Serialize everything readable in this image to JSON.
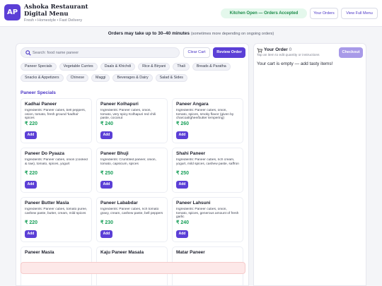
{
  "header": {
    "logo_text": "AP",
    "title": "Ashoka Restaurant Digital Menu",
    "subtitle": "Fresh • Homestyle • Fast Delivery",
    "status": "Kitchen Open — Orders Accepted",
    "orders_label": "Your Orders",
    "menu_label": "View Full Menu"
  },
  "notice": {
    "main": "Orders may take up to 30–40 minutes",
    "small": "(sometimes more depending on ongoing orders)"
  },
  "toolbar": {
    "search_placeholder": "Search: food name paneer",
    "clear_label": "Clear Cart",
    "review_label": "Review Order"
  },
  "categories": [
    [
      "Paneer Specials",
      "Vegetable Curries",
      "Daals & Khichdi",
      "Rice & Biryani",
      "Thali",
      "Breads & Paratha"
    ],
    [
      "Snacks & Appetizers",
      "Chinese",
      "Maggi",
      "Beverages & Dairy",
      "Salad & Sides"
    ]
  ],
  "section": {
    "title": "Paneer Specials"
  },
  "items": [
    {
      "name": "Kadhai Paneer",
      "ingredients": "Ingredients: Paneer cubes, bell peppers, onion, tomato, fresh ground 'kadhai' spices",
      "price": "₹ 220",
      "add": "Add"
    },
    {
      "name": "Paneer Kolhapuri",
      "ingredients": "Ingredients: Paneer cubes, onion, tomato, very spicy Kolhapuri red chili paste, coconut",
      "price": "₹ 240",
      "add": "Add"
    },
    {
      "name": "Paneer Angara",
      "ingredients": "Ingredients: Paneer cubes, onion, tomato, spices, smoky flavor (given by charcoal/ghee/butter tempering)",
      "price": "₹ 260",
      "add": "Add"
    },
    {
      "name": "Paneer Do Pyaaza",
      "ingredients": "Ingredients: Paneer cubes, onion (cooked & raw), tomato, spices, yogurt",
      "price": "₹ 220",
      "add": "Add"
    },
    {
      "name": "Paneer Bhuji",
      "ingredients": "Ingredients: Crumbled paneer, onion, tomato, capsicum, spices",
      "price": "₹ 250",
      "add": "Add"
    },
    {
      "name": "Shahi Paneer",
      "ingredients": "Ingredients: Paneer cubes, rich cream, yogurt, mild spices, cashew paste, saffron",
      "price": "₹ 250",
      "add": "Add"
    },
    {
      "name": "Paneer Butter Masla",
      "ingredients": "Ingredients: Paneer cubes, tomato puree, cashew paste, butter, cream, mild spices",
      "price": "₹ 220",
      "add": "Add"
    },
    {
      "name": "Paneer Lababdar",
      "ingredients": "Ingredients: Paneer cubes, rich tomato gravy, cream, cashew paste, bell peppers",
      "price": "₹ 230",
      "add": "Add"
    },
    {
      "name": "Paneer Lahsuni",
      "ingredients": "Ingredients: Paneer cubes, onion, tomato, spices, generous amount of fresh garlic",
      "price": "₹ 240",
      "add": "Add"
    },
    {
      "name": "Paneer Masla",
      "ingredients": "",
      "price": "",
      "add": ""
    },
    {
      "name": "Kaju Paneer Masala",
      "ingredients": "",
      "price": "",
      "add": ""
    },
    {
      "name": "Matar Paneer",
      "ingredients": "",
      "price": "",
      "add": ""
    }
  ],
  "cart": {
    "title": "Your Order",
    "count": "0",
    "subtitle": "Tap an item to edit quantity or instructions",
    "checkout_label": "Checkout",
    "empty_text": "Your cart is empty — add tasty items!"
  },
  "colors": {
    "accent": "#5b3fd6",
    "price": "#1aa05a",
    "status_bg": "#e4f8ec",
    "status_text": "#1a8a48"
  }
}
